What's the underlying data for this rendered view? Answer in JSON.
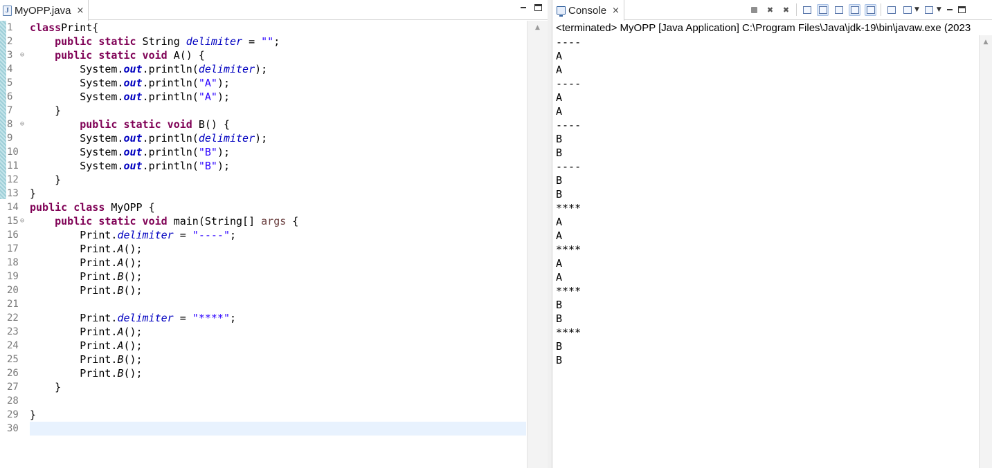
{
  "editor": {
    "tab_label": "MyOPP.java",
    "file_icon_letter": "J",
    "close_glyph": "×",
    "code_lines": [
      {
        "n": "1",
        "fold": false,
        "tokens": [
          [
            "kw",
            "class"
          ],
          [
            "",
            "Print{"
          ]
        ]
      },
      {
        "n": "2",
        "fold": false,
        "tokens": [
          [
            "",
            "    "
          ],
          [
            "kw",
            "public static"
          ],
          [
            "",
            " String "
          ],
          [
            "fld",
            "delimiter"
          ],
          [
            "",
            " = "
          ],
          [
            "str",
            "\"\""
          ],
          [
            "",
            ";"
          ]
        ]
      },
      {
        "n": "3",
        "fold": true,
        "tokens": [
          [
            "",
            "    "
          ],
          [
            "kw",
            "public static void"
          ],
          [
            "",
            " A() {"
          ]
        ]
      },
      {
        "n": "4",
        "fold": false,
        "tokens": [
          [
            "",
            "        System."
          ],
          [
            "sfld",
            "out"
          ],
          [
            "",
            ".println("
          ],
          [
            "fld",
            "delimiter"
          ],
          [
            "",
            ");"
          ]
        ]
      },
      {
        "n": "5",
        "fold": false,
        "tokens": [
          [
            "",
            "        System."
          ],
          [
            "sfld",
            "out"
          ],
          [
            "",
            ".println("
          ],
          [
            "str",
            "\"A\""
          ],
          [
            "",
            ");"
          ]
        ]
      },
      {
        "n": "6",
        "fold": false,
        "tokens": [
          [
            "",
            "        System."
          ],
          [
            "sfld",
            "out"
          ],
          [
            "",
            ".println("
          ],
          [
            "str",
            "\"A\""
          ],
          [
            "",
            ");"
          ]
        ]
      },
      {
        "n": "7",
        "fold": false,
        "tokens": [
          [
            "",
            "    }"
          ]
        ]
      },
      {
        "n": "8",
        "fold": true,
        "tokens": [
          [
            "",
            "        "
          ],
          [
            "kw",
            "public static void"
          ],
          [
            "",
            " B() {"
          ]
        ]
      },
      {
        "n": "9",
        "fold": false,
        "tokens": [
          [
            "",
            "        System."
          ],
          [
            "sfld",
            "out"
          ],
          [
            "",
            ".println("
          ],
          [
            "fld",
            "delimiter"
          ],
          [
            "",
            ");"
          ]
        ]
      },
      {
        "n": "10",
        "fold": false,
        "tokens": [
          [
            "",
            "        System."
          ],
          [
            "sfld",
            "out"
          ],
          [
            "",
            ".println("
          ],
          [
            "str",
            "\"B\""
          ],
          [
            "",
            ");"
          ]
        ]
      },
      {
        "n": "11",
        "fold": false,
        "tokens": [
          [
            "",
            "        System."
          ],
          [
            "sfld",
            "out"
          ],
          [
            "",
            ".println("
          ],
          [
            "str",
            "\"B\""
          ],
          [
            "",
            ");"
          ]
        ]
      },
      {
        "n": "12",
        "fold": false,
        "tokens": [
          [
            "",
            "    }"
          ]
        ]
      },
      {
        "n": "13",
        "fold": false,
        "tokens": [
          [
            "",
            "}"
          ]
        ]
      },
      {
        "n": "14",
        "fold": false,
        "tokens": [
          [
            "kw",
            "public class"
          ],
          [
            "",
            " MyOPP {"
          ]
        ]
      },
      {
        "n": "15",
        "fold": true,
        "tokens": [
          [
            "",
            "    "
          ],
          [
            "kw",
            "public static void"
          ],
          [
            "",
            " main(String[] "
          ],
          [
            "prm",
            "args"
          ],
          [
            "",
            " {"
          ]
        ]
      },
      {
        "n": "16",
        "fold": false,
        "tokens": [
          [
            "",
            "        Print."
          ],
          [
            "fld",
            "delimiter"
          ],
          [
            "",
            " = "
          ],
          [
            "str",
            "\"----\""
          ],
          [
            "",
            ";"
          ]
        ]
      },
      {
        "n": "17",
        "fold": false,
        "tokens": [
          [
            "",
            "        Print."
          ],
          [
            "mth",
            "A"
          ],
          [
            "",
            "();"
          ]
        ]
      },
      {
        "n": "18",
        "fold": false,
        "tokens": [
          [
            "",
            "        Print."
          ],
          [
            "mth",
            "A"
          ],
          [
            "",
            "();"
          ]
        ]
      },
      {
        "n": "19",
        "fold": false,
        "tokens": [
          [
            "",
            "        Print."
          ],
          [
            "mth",
            "B"
          ],
          [
            "",
            "();"
          ]
        ]
      },
      {
        "n": "20",
        "fold": false,
        "tokens": [
          [
            "",
            "        Print."
          ],
          [
            "mth",
            "B"
          ],
          [
            "",
            "();"
          ]
        ]
      },
      {
        "n": "21",
        "fold": false,
        "tokens": [
          [
            "",
            ""
          ]
        ]
      },
      {
        "n": "22",
        "fold": false,
        "tokens": [
          [
            "",
            "        Print."
          ],
          [
            "fld",
            "delimiter"
          ],
          [
            "",
            " = "
          ],
          [
            "str",
            "\"****\""
          ],
          [
            "",
            ";"
          ]
        ]
      },
      {
        "n": "23",
        "fold": false,
        "tokens": [
          [
            "",
            "        Print."
          ],
          [
            "mth",
            "A"
          ],
          [
            "",
            "();"
          ]
        ]
      },
      {
        "n": "24",
        "fold": false,
        "tokens": [
          [
            "",
            "        Print."
          ],
          [
            "mth",
            "A"
          ],
          [
            "",
            "();"
          ]
        ]
      },
      {
        "n": "25",
        "fold": false,
        "tokens": [
          [
            "",
            "        Print."
          ],
          [
            "mth",
            "B"
          ],
          [
            "",
            "();"
          ]
        ]
      },
      {
        "n": "26",
        "fold": false,
        "tokens": [
          [
            "",
            "        Print."
          ],
          [
            "mth",
            "B"
          ],
          [
            "",
            "();"
          ]
        ]
      },
      {
        "n": "27",
        "fold": false,
        "tokens": [
          [
            "",
            "    }"
          ]
        ]
      },
      {
        "n": "28",
        "fold": false,
        "tokens": [
          [
            "",
            ""
          ]
        ]
      },
      {
        "n": "29",
        "fold": false,
        "tokens": [
          [
            "",
            "}"
          ]
        ]
      },
      {
        "n": "30",
        "fold": false,
        "tokens": [
          [
            "",
            ""
          ]
        ]
      }
    ],
    "current_line": "30",
    "fold_glyph": "⊖",
    "scroll_up_glyph": "▲"
  },
  "console": {
    "tab_label": "Console",
    "close_glyph": "×",
    "status": "<terminated> MyOPP [Java Application] C:\\Program Files\\Java\\jdk-19\\bin\\javaw.exe  (2023",
    "output": [
      "----",
      "A",
      "A",
      "----",
      "A",
      "A",
      "----",
      "B",
      "B",
      "----",
      "B",
      "B",
      "****",
      "A",
      "A",
      "****",
      "A",
      "A",
      "****",
      "B",
      "B",
      "****",
      "B",
      "B"
    ],
    "scroll_up_glyph": "▲"
  },
  "colors": {
    "keyword": "#7f0055",
    "string": "#2a00ff",
    "field": "#0000c0",
    "current_line": "#e8f2fe"
  }
}
